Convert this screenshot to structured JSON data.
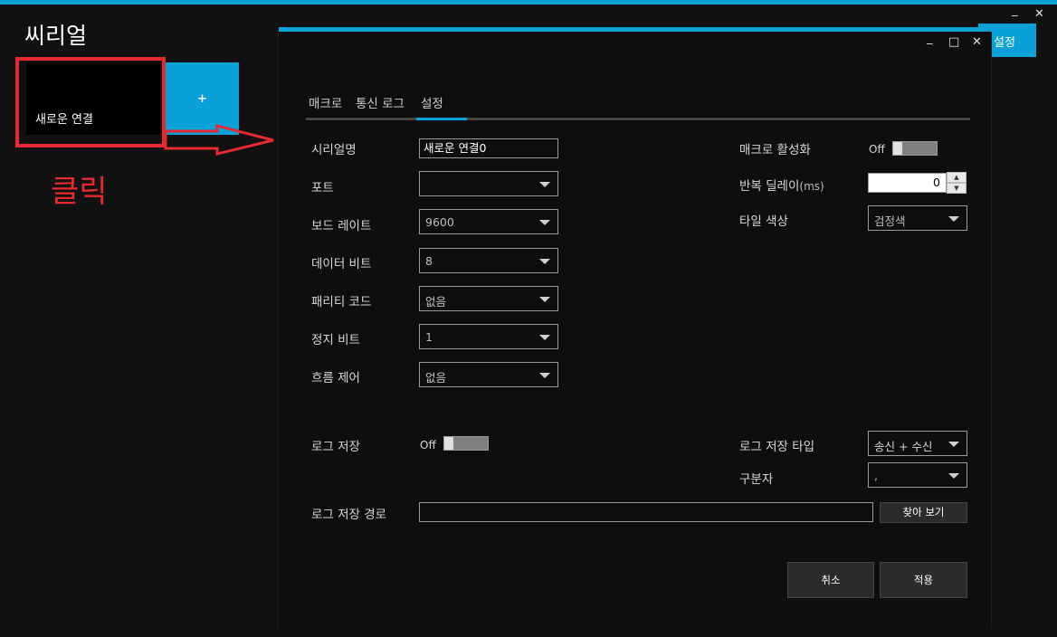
{
  "app": {
    "title": "씨리얼",
    "minimize_label": "_",
    "close_label": "✕"
  },
  "tiles": {
    "new_connection_label": "새로운 연결",
    "add_label": "+",
    "settings_label": "설정"
  },
  "annotation": {
    "click_label": "클릭",
    "color": "#e8292f"
  },
  "dialog": {
    "minimize_label": "_",
    "maximize_label": "□",
    "close_label": "✕",
    "tabs": [
      {
        "label": "매크로"
      },
      {
        "label": "통신 로그"
      },
      {
        "label": "설정",
        "active": true
      }
    ],
    "serial_name": {
      "label": "시리얼명",
      "value": "새로운 연결0"
    },
    "port": {
      "label": "포트",
      "value": ""
    },
    "baud_rate": {
      "label": "보드 레이트",
      "value": "9600"
    },
    "data_bits": {
      "label": "데이터 비트",
      "value": "8"
    },
    "parity": {
      "label": "패리티 코드",
      "value": "없음"
    },
    "stop_bits": {
      "label": "정지 비트",
      "value": "1"
    },
    "flow_control": {
      "label": "흐름 제어",
      "value": "없음"
    },
    "macro_enable": {
      "label": "매크로 활성화",
      "state_label": "Off"
    },
    "repeat_delay": {
      "label_main": "반복 딜레이",
      "label_unit": "(ms)",
      "value": "0",
      "up_label": "▲",
      "down_label": "▼"
    },
    "tile_color": {
      "label": "타일 색상",
      "value": "검정색"
    },
    "log_save": {
      "label": "로그 저장",
      "state_label": "Off"
    },
    "log_type": {
      "label": "로그 저장 타입",
      "value": "송신 + 수신"
    },
    "separator": {
      "label": "구분자",
      "value": ","
    },
    "log_path": {
      "label": "로그 저장 경로",
      "value": "",
      "browse_label": "찾아 보기"
    },
    "cancel_label": "취소",
    "apply_label": "적용"
  },
  "colors": {
    "accent": "#0aa0d8",
    "background": "#111111"
  }
}
